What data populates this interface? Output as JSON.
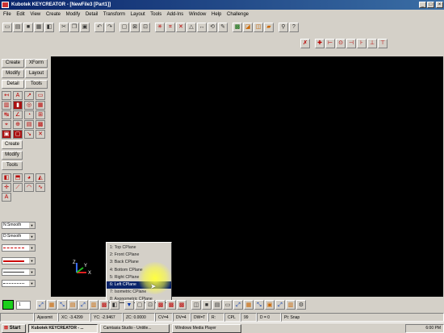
{
  "window": {
    "title": "Kubotek KEYCREATOR - [NewFile3 [Part1]]",
    "min": "_",
    "max": "□",
    "close": "×"
  },
  "menu": [
    "File",
    "Edit",
    "View",
    "Create",
    "Modify",
    "Detail",
    "Transform",
    "Layout",
    "Tools",
    "Add-Ins",
    "Window",
    "Help",
    "Challenge"
  ],
  "panel": {
    "tabs_top": [
      "Create",
      "XForm",
      "Modify",
      "Layout",
      "Detail",
      "Tools"
    ],
    "tabs_mid": [
      "Create",
      "Modify",
      "Tools"
    ],
    "dropdowns": [
      "N:Smooth",
      "D:Smooth"
    ]
  },
  "cplane_menu": {
    "items": [
      "1: Top CPlane",
      "2: Front CPlane",
      "3: Back CPlane",
      "4: Bottom CPlane",
      "5: Right CPlane",
      "6: Left CPlane",
      "7: Isometric CPlane",
      "8: Axonometric CPlane"
    ],
    "selected_index": 5
  },
  "axes": {
    "x": "X",
    "y": "Y",
    "z": "Z"
  },
  "bottom": {
    "level": "1",
    "color_hex": "#1bd01b"
  },
  "status": {
    "view": "Ajaxsmit",
    "xc": "XC: -3.4299",
    "yc": "YC: -2.9467",
    "zc": "ZC: 0.0000",
    "cview": "CV=4",
    "dview": "DV=4",
    "dw": "DW=T",
    "box": "R:",
    "cpl": "CPL",
    "cpl_val": "99",
    "d": "D = 0",
    "snap": "Pt: Snap"
  },
  "taskbar": {
    "start": "Start",
    "tasks": [
      "Kubotek KEYCREATOR - ...",
      "Camtasia Studio - Untitle...",
      "Windows Media Player"
    ],
    "active_index": 0,
    "clock": "6:00 PM"
  }
}
